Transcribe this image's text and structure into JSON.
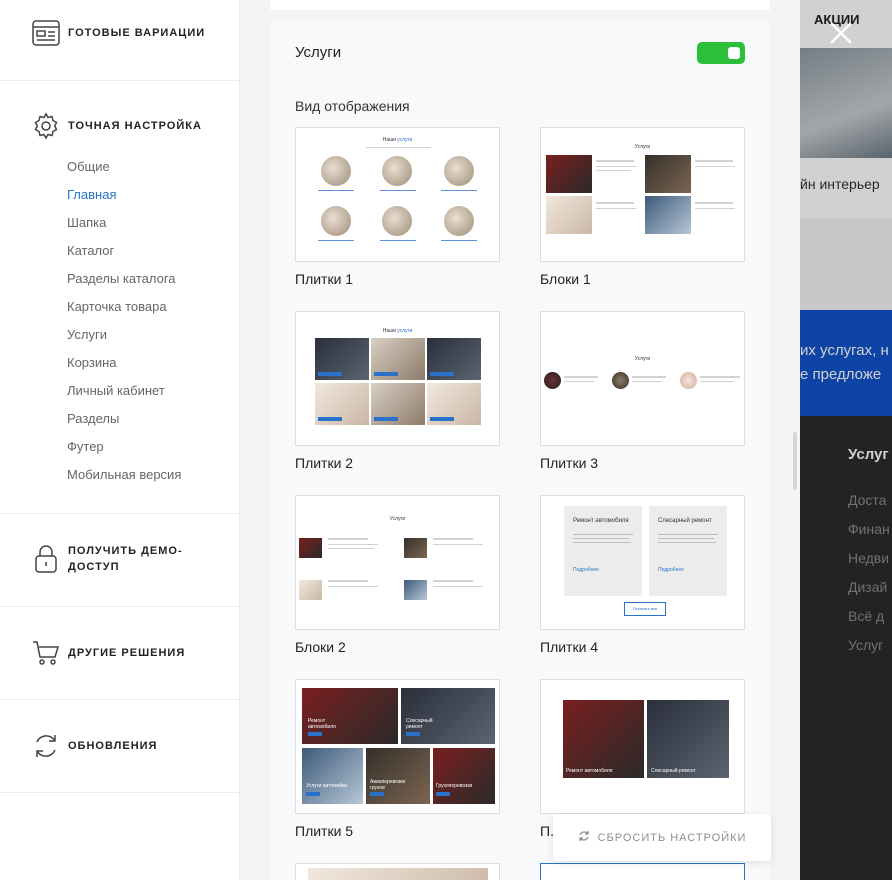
{
  "sidebar": {
    "variations": "Готовые вариации",
    "fine_tuning": "Точная настройка",
    "items": [
      "Общие",
      "Главная",
      "Шапка",
      "Каталог",
      "Разделы каталога",
      "Карточка товара",
      "Услуги",
      "Корзина",
      "Личный кабинет",
      "Разделы",
      "Футер",
      "Мобильная версия"
    ],
    "active_item": "Главная",
    "demo": "Получить демо-доступ",
    "other": "Другие решения",
    "updates": "Обновления"
  },
  "panel": {
    "section_title": "Услуги",
    "toggle_on": true,
    "view_label": "Вид отображения",
    "options": [
      "Плитки 1",
      "Блоки 1",
      "Плитки 2",
      "Плитки 3",
      "Блоки 2",
      "Плитки 4",
      "Плитки 5",
      "П..."
    ],
    "reset_label": "Сбросить настройки"
  },
  "thumbs": {
    "our": "Наши",
    "services": "услуги",
    "services_cap": "Услуги",
    "auto_repair": "Ремонт автомобиля",
    "locksmith": "Слесарный ремонт",
    "auto_services": "Услуги автомойки",
    "cargo": "Авиаперевозки грузов",
    "cargo2": "Грузоперевозки",
    "more": "Подробнее",
    "show_all": "Показать все"
  },
  "site": {
    "promo": "АКЦИИ",
    "text1": "йн интерьер",
    "text2": "их услугах, н",
    "text3": "е предложе",
    "heading": "Услуг",
    "links": [
      "Доста",
      "Финан",
      "Недви",
      "Дизай",
      "Всё д",
      "Услуг"
    ]
  },
  "colors": {
    "accent": "#2a72c9",
    "toggle": "#2bbf3a",
    "site_blue": "#0f52c9"
  }
}
